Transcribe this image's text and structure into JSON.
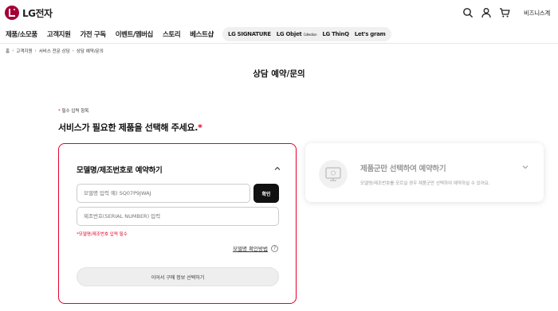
{
  "header": {
    "logo_text": "LG전자",
    "business_link": "비즈니스계"
  },
  "gnb": {
    "items": [
      "제품/소모품",
      "고객지원",
      "가전 구독",
      "이벤트/멤버십",
      "스토리",
      "베스트샵"
    ],
    "brands": [
      "LG SIGNATURE",
      "LG Objet",
      "LG ThinQ",
      "Let's gram"
    ],
    "objet_suffix": "Collection"
  },
  "breadcrumb": [
    "홈",
    "고객지원",
    "서비스 전문 상담",
    "상담 예약/문의"
  ],
  "page_title": "상담 예약/문의",
  "required_note": "필수 입력 항목",
  "section_title": "서비스가 필요한 제품을 선택해 주세요.",
  "model_card": {
    "title": "모델명/제조번호로 예약하기",
    "model_placeholder": "모델명 입력 예) SQ07P9JWAJ",
    "confirm_label": "확인",
    "serial_placeholder": "제조번호(SERIAL NUMBER) 입력",
    "error_text": "*모델명/제조번호 입력 필수",
    "help_label": "모델명 확인방법",
    "next_label": "이어서 구매 정보 선택하기"
  },
  "category_card": {
    "title": "제품군만 선택하여 예약하기",
    "description": "모델명/제조번호를 모르실 경우 제품군만 선택하여 예약하실 수 있어요."
  },
  "colors": {
    "accent": "#e4002b",
    "brand": "#a50034"
  }
}
